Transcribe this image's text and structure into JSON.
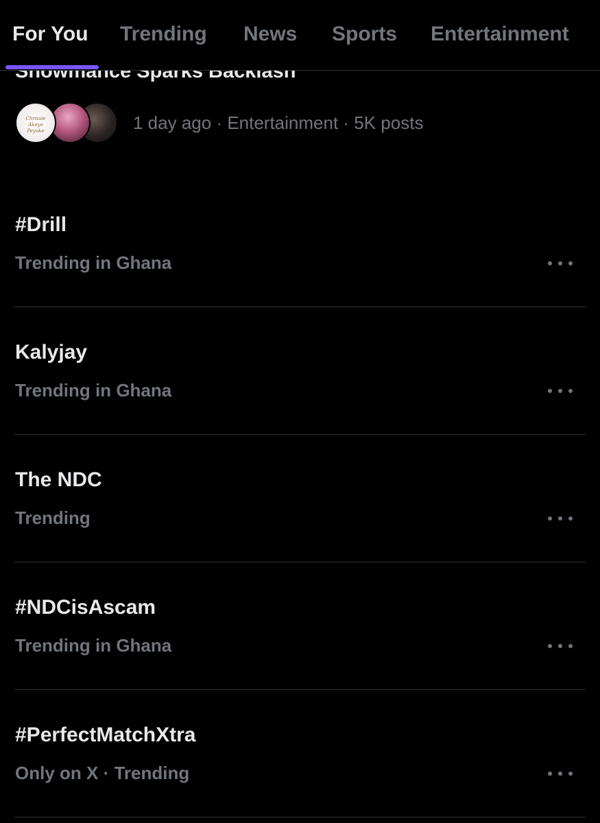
{
  "tabs": [
    {
      "label": "For You",
      "active": true
    },
    {
      "label": "Trending",
      "active": false
    },
    {
      "label": "News",
      "active": false
    },
    {
      "label": "Sports",
      "active": false
    },
    {
      "label": "Entertainment",
      "active": false
    }
  ],
  "colors": {
    "background": "#000000",
    "primary_text": "#e7e9ea",
    "secondary_text": "#71767b",
    "divider": "#2f3336",
    "accent": "#7856ff"
  },
  "story": {
    "title": "Showmance Sparks Backlash",
    "meta": "1 day ago · Entertainment · 5K posts",
    "avatar_mark": "Chrissie Akeyo Peyoke"
  },
  "trends": [
    {
      "name": "#Drill",
      "context": "Trending in Ghana",
      "more_icon": "more-horizontal-icon"
    },
    {
      "name": "Kalyjay",
      "context": "Trending in Ghana",
      "more_icon": "more-horizontal-icon"
    },
    {
      "name": "The NDC",
      "context": "Trending",
      "more_icon": "more-horizontal-icon"
    },
    {
      "name": "#NDCisAscam",
      "context": "Trending in Ghana",
      "more_icon": "more-horizontal-icon"
    },
    {
      "name": "#PerfectMatchXtra",
      "context": "Only on X · Trending",
      "more_icon": "more-horizontal-icon"
    }
  ]
}
